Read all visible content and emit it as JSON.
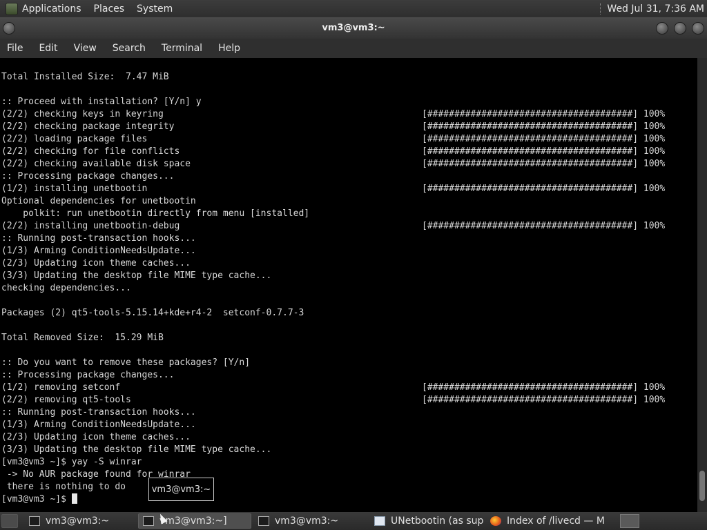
{
  "top_panel": {
    "menus": [
      "Applications",
      "Places",
      "System"
    ],
    "clock": "Wed Jul 31,  7:36 AM"
  },
  "window": {
    "title": "vm3@vm3:~"
  },
  "menubar": {
    "items": [
      "File",
      "Edit",
      "View",
      "Search",
      "Terminal",
      "Help"
    ]
  },
  "terminal": {
    "lines": [
      {
        "text": "Total Installed Size:  7.47 MiB",
        "progress": ""
      },
      {
        "text": "",
        "progress": ""
      },
      {
        "text": ":: Proceed with installation? [Y/n] y",
        "progress": ""
      },
      {
        "text": "(2/2) checking keys in keyring",
        "progress": "[######################################] 100%"
      },
      {
        "text": "(2/2) checking package integrity",
        "progress": "[######################################] 100%"
      },
      {
        "text": "(2/2) loading package files",
        "progress": "[######################################] 100%"
      },
      {
        "text": "(2/2) checking for file conflicts",
        "progress": "[######################################] 100%"
      },
      {
        "text": "(2/2) checking available disk space",
        "progress": "[######################################] 100%"
      },
      {
        "text": ":: Processing package changes...",
        "progress": ""
      },
      {
        "text": "(1/2) installing unetbootin",
        "progress": "[######################################] 100%"
      },
      {
        "text": "Optional dependencies for unetbootin",
        "progress": ""
      },
      {
        "text": "    polkit: run unetbootin directly from menu [installed]",
        "progress": ""
      },
      {
        "text": "(2/2) installing unetbootin-debug",
        "progress": "[######################################] 100%"
      },
      {
        "text": ":: Running post-transaction hooks...",
        "progress": ""
      },
      {
        "text": "(1/3) Arming ConditionNeedsUpdate...",
        "progress": ""
      },
      {
        "text": "(2/3) Updating icon theme caches...",
        "progress": ""
      },
      {
        "text": "(3/3) Updating the desktop file MIME type cache...",
        "progress": ""
      },
      {
        "text": "checking dependencies...",
        "progress": ""
      },
      {
        "text": "",
        "progress": ""
      },
      {
        "text": "Packages (2) qt5-tools-5.15.14+kde+r4-2  setconf-0.7.7-3",
        "progress": ""
      },
      {
        "text": "",
        "progress": ""
      },
      {
        "text": "Total Removed Size:  15.29 MiB",
        "progress": ""
      },
      {
        "text": "",
        "progress": ""
      },
      {
        "text": ":: Do you want to remove these packages? [Y/n]",
        "progress": ""
      },
      {
        "text": ":: Processing package changes...",
        "progress": ""
      },
      {
        "text": "(1/2) removing setconf",
        "progress": "[######################################] 100%"
      },
      {
        "text": "(2/2) removing qt5-tools",
        "progress": "[######################################] 100%"
      },
      {
        "text": ":: Running post-transaction hooks...",
        "progress": ""
      },
      {
        "text": "(1/3) Arming ConditionNeedsUpdate...",
        "progress": ""
      },
      {
        "text": "(2/3) Updating icon theme caches...",
        "progress": ""
      },
      {
        "text": "(3/3) Updating the desktop file MIME type cache...",
        "progress": ""
      },
      {
        "text": "[vm3@vm3 ~]$ yay -S winrar",
        "progress": ""
      },
      {
        "text": " -> No AUR package found for winrar",
        "progress": ""
      },
      {
        "text": " there is nothing to do",
        "progress": ""
      }
    ],
    "prompt": "[vm3@vm3 ~]$ "
  },
  "tooltip": "vm3@vm3:~",
  "taskbar": {
    "tasks": [
      {
        "label": "vm3@vm3:~",
        "icon": "terminal-icon"
      },
      {
        "label": "vm3@vm3:~]",
        "icon": "terminal-icon"
      },
      {
        "label": "vm3@vm3:~",
        "icon": "terminal-icon"
      },
      {
        "label": "UNetbootin (as sup...",
        "icon": "unetbootin-icon"
      },
      {
        "label": "Index of /livecd — M...",
        "icon": "firefox-icon"
      }
    ]
  }
}
